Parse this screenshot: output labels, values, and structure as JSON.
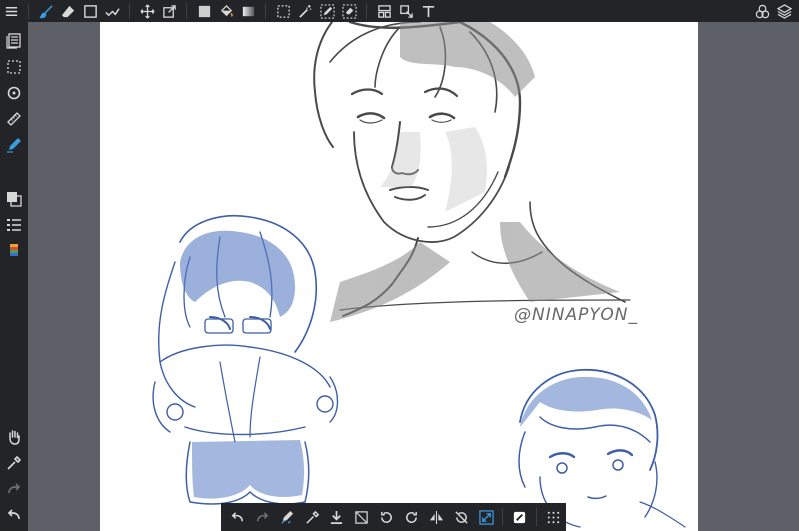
{
  "canvas": {
    "signature": "@NINAPYON_",
    "background": "#ffffff"
  },
  "colors": {
    "accent": "#3b9be0",
    "toolbar_bg": "#222427",
    "workspace_bg": "#5d6167",
    "ink_gray": "#4a4a4a",
    "ink_blue": "#3d5ea8"
  },
  "top_toolbar": {
    "tools": [
      "menu-icon",
      "brush-icon",
      "eraser-icon",
      "rectangle-icon",
      "smudge-icon",
      "move-icon",
      "transform-icon",
      "fill-color-icon",
      "bucket-icon",
      "gradient-icon",
      "select-rect-icon",
      "magic-wand-icon",
      "select-pen-icon",
      "select-eraser-icon",
      "frame-icon",
      "operation-icon",
      "text-icon"
    ],
    "right_tools": [
      "materials-icon",
      "layers-icon"
    ]
  },
  "sidebar": {
    "tools": [
      "pages-icon",
      "selection-icon",
      "rotate-icon",
      "ruler-icon",
      "pen-icon",
      "layer-copy-icon",
      "list-icon",
      "color-icon",
      "hand-icon",
      "eyedropper-icon",
      "redo-icon",
      "undo-icon"
    ]
  },
  "bottom_toolbar": {
    "tools": [
      "undo-icon",
      "redo-icon",
      "pen-snap-icon",
      "eyedropper-icon",
      "save-icon",
      "deselect-icon",
      "rotate-left-icon",
      "rotate-right-icon",
      "flip-icon",
      "reset-rotation-icon",
      "fit-screen-icon",
      "color-swap-icon",
      "grid-icon"
    ]
  }
}
